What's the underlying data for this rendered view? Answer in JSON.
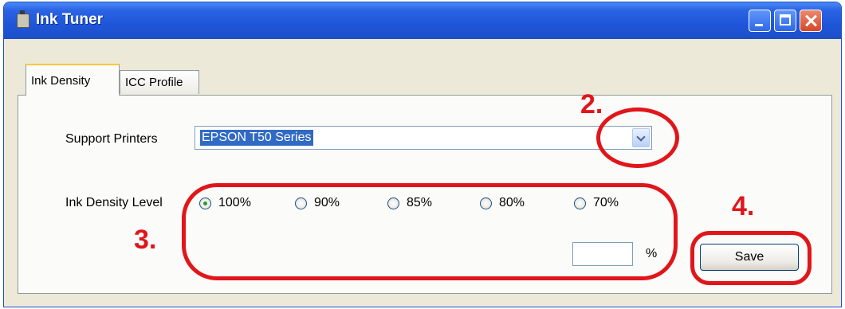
{
  "window": {
    "title": "Ink Tuner",
    "icon": "printer-icon"
  },
  "tabs": [
    {
      "label": "Ink Density",
      "active": true
    },
    {
      "label": "ICC Profile",
      "active": false
    }
  ],
  "support_printers": {
    "label": "Support Printers",
    "selected": "EPSON T50 Series"
  },
  "ink_density": {
    "label": "Ink Density Level",
    "options": [
      {
        "label": "100%",
        "checked": true
      },
      {
        "label": "90%",
        "checked": false
      },
      {
        "label": "85%",
        "checked": false
      },
      {
        "label": "80%",
        "checked": false
      },
      {
        "label": "70%",
        "checked": false
      }
    ],
    "custom_value": "",
    "unit": "%"
  },
  "buttons": {
    "save": "Save"
  },
  "annotations": {
    "mark_2": "2.",
    "mark_3": "3.",
    "mark_4": "4.",
    "color": "#e0161b"
  }
}
